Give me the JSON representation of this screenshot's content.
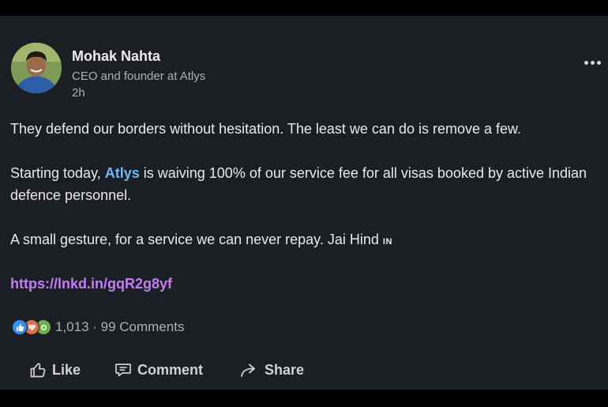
{
  "post": {
    "author": {
      "name": "Mohak Nahta",
      "title": "CEO and founder at Atlys",
      "time": "2h"
    },
    "paragraph1": "They defend our borders without hesitation. The least we can do is remove a few.",
    "paragraph2_prefix": "Starting today, ",
    "paragraph2_mention": "Atlys",
    "paragraph2_suffix": " is waiving 100% of our service fee for all visas booked by active Indian defence personnel.",
    "paragraph3_text": "A small gesture, for a service we can never repay. Jai Hind ",
    "paragraph3_flag": "IN",
    "link": "https://lnkd.in/gqR2g8yf"
  },
  "reactions": {
    "icons": [
      "like-icon",
      "love-icon",
      "support-icon"
    ],
    "summary": "1,013 · 99 Comments"
  },
  "actions": {
    "like": "Like",
    "comment": "Comment",
    "share": "Share"
  },
  "colors": {
    "background": "#1b1f23",
    "mention": "#71b7fb",
    "link": "#c37df7"
  }
}
